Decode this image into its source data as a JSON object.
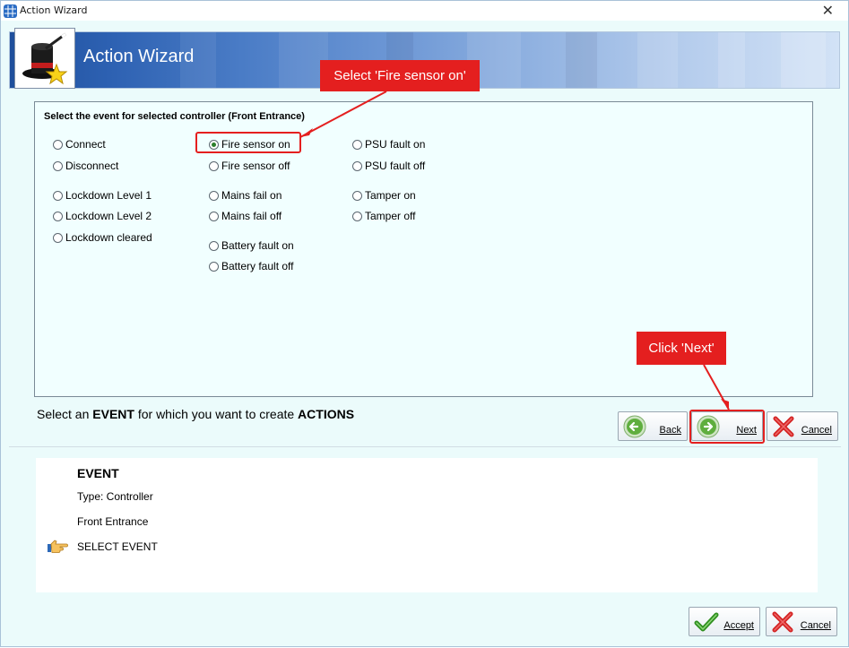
{
  "window": {
    "title": "Action Wizard",
    "close_glyph": "✕"
  },
  "banner": {
    "title": "Action Wizard",
    "logo_icon": "magic-hat-icon"
  },
  "panel": {
    "heading": "Select the event for selected controller (Front Entrance)",
    "columns": [
      [
        {
          "label": "Connect",
          "selected": false
        },
        {
          "label": "Disconnect",
          "selected": false
        },
        {
          "label": "Lockdown Level 1",
          "selected": false
        },
        {
          "label": "Lockdown Level 2",
          "selected": false
        },
        {
          "label": "Lockdown cleared",
          "selected": false
        }
      ],
      [
        {
          "label": "Fire sensor on",
          "selected": true
        },
        {
          "label": "Fire sensor off",
          "selected": false
        },
        {
          "label": "Mains fail on",
          "selected": false
        },
        {
          "label": "Mains fail off",
          "selected": false
        },
        {
          "label": "Battery fault on",
          "selected": false
        },
        {
          "label": "Battery fault off",
          "selected": false
        }
      ],
      [
        {
          "label": "PSU fault on",
          "selected": false
        },
        {
          "label": "PSU fault off",
          "selected": false
        },
        {
          "label": "Tamper on",
          "selected": false
        },
        {
          "label": "Tamper off",
          "selected": false
        }
      ]
    ]
  },
  "instruction": {
    "prefix": "Select an",
    "bold1": "EVENT",
    "middle": "for which you want to create",
    "bold2": "ACTIONS"
  },
  "nav": {
    "back": "Back",
    "next": "Next",
    "cancel": "Cancel"
  },
  "summary": {
    "title": "EVENT",
    "type": "Type: Controller",
    "controller": "Front Entrance",
    "step": "SELECT EVENT",
    "pointer_icon": "pointing-hand-icon"
  },
  "footer": {
    "accept": "Accept",
    "cancel": "Cancel"
  },
  "annotations": {
    "callout_fire": "Select 'Fire sensor on'",
    "callout_next": "Click 'Next'",
    "color": "#e41f1f"
  }
}
